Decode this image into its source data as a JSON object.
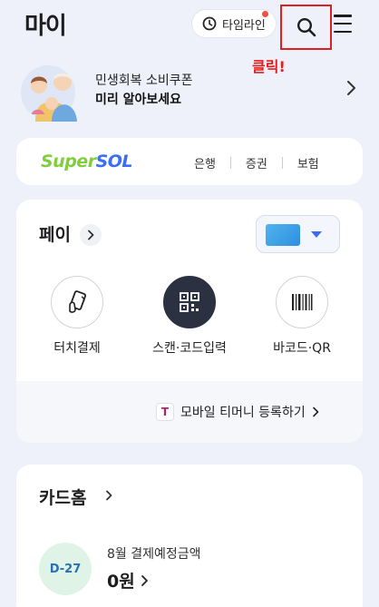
{
  "header": {
    "title": "마이",
    "timeline_label": "타임라인",
    "search_icon": "search-icon",
    "menu_icon": "hamburger-menu-icon",
    "annotation": "클릭!"
  },
  "promo": {
    "line1": "민생회복 소비쿠폰",
    "line2": "미리 알아보세요"
  },
  "supersol": {
    "logo_part1": "Super",
    "logo_part2": "SOL",
    "links": [
      "은행",
      "증권",
      "보험"
    ]
  },
  "pay": {
    "title": "페이",
    "options": [
      "터치결제",
      "스캔·코드입력",
      "바코드·QR"
    ],
    "tmoney_icon_letter": "T",
    "tmoney_label": "모바일 티머니 등록하기"
  },
  "cardhome": {
    "title": "카드홈",
    "dday": "D-27",
    "label": "8월 결제예정금액",
    "amount": "0원"
  },
  "colors": {
    "background": "#eef1f9",
    "accent_blue": "#3b6ef5",
    "supersol_green": "#7fcf3d",
    "highlight_red": "#e02020",
    "notification_dot": "#f0503c"
  }
}
